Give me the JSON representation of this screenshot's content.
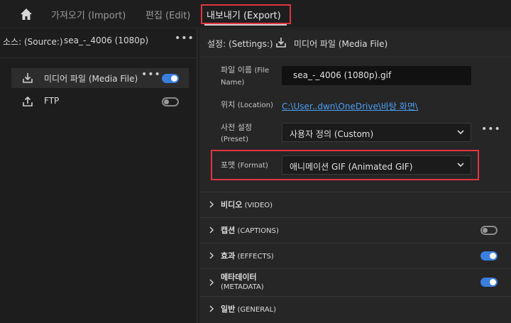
{
  "nav": {
    "import_label": "가져오기 (Import)",
    "edit_label": "편집 (Edit)",
    "export_label": "내보내기 (Export)"
  },
  "source": {
    "label": "소스: (Source:)",
    "name": "sea_-_4006 (1080p)",
    "menu": "•••"
  },
  "destinations": [
    {
      "label": "미디어 파일 (Media File)",
      "dots": "•••",
      "enabled": true
    },
    {
      "label": "FTP",
      "enabled": false
    }
  ],
  "settings": {
    "label": "설정: (Settings:)",
    "destination": "미디어 파일 (Media File)",
    "file_name_label_ko": "파일 이름",
    "file_name_label_en1": "(File",
    "file_name_label_en2": "Name)",
    "file_name_value": "sea_-_4006 (1080p).gif",
    "location_label_ko": "위치",
    "location_label_en": "(Location)",
    "location_value": "C:\\User..dwn\\OneDrive\\바탕 화면\\",
    "preset_label_ko": "사전 설정",
    "preset_label_en": "(Preset)",
    "preset_value": "사용자 정의 (Custom)",
    "preset_dots": "•••",
    "format_label_ko": "포맷",
    "format_label_en": "(Format)",
    "format_value": "애니메이션 GIF (Animated GIF)"
  },
  "sections": [
    {
      "ko": "비디오",
      "en": "(VIDEO)"
    },
    {
      "ko": "캡션",
      "en": "(CAPTIONS)",
      "toggle": false
    },
    {
      "ko": "효과",
      "en": "(EFFECTS)",
      "toggle": true
    },
    {
      "ko": "메타데이터",
      "en": "(METADATA)",
      "toggle": true
    },
    {
      "ko": "일반",
      "en": "(GENERAL)"
    }
  ],
  "colors": {
    "accent": "#3a7fde",
    "highlight": "#e0353f",
    "link": "#4a9ff5"
  }
}
